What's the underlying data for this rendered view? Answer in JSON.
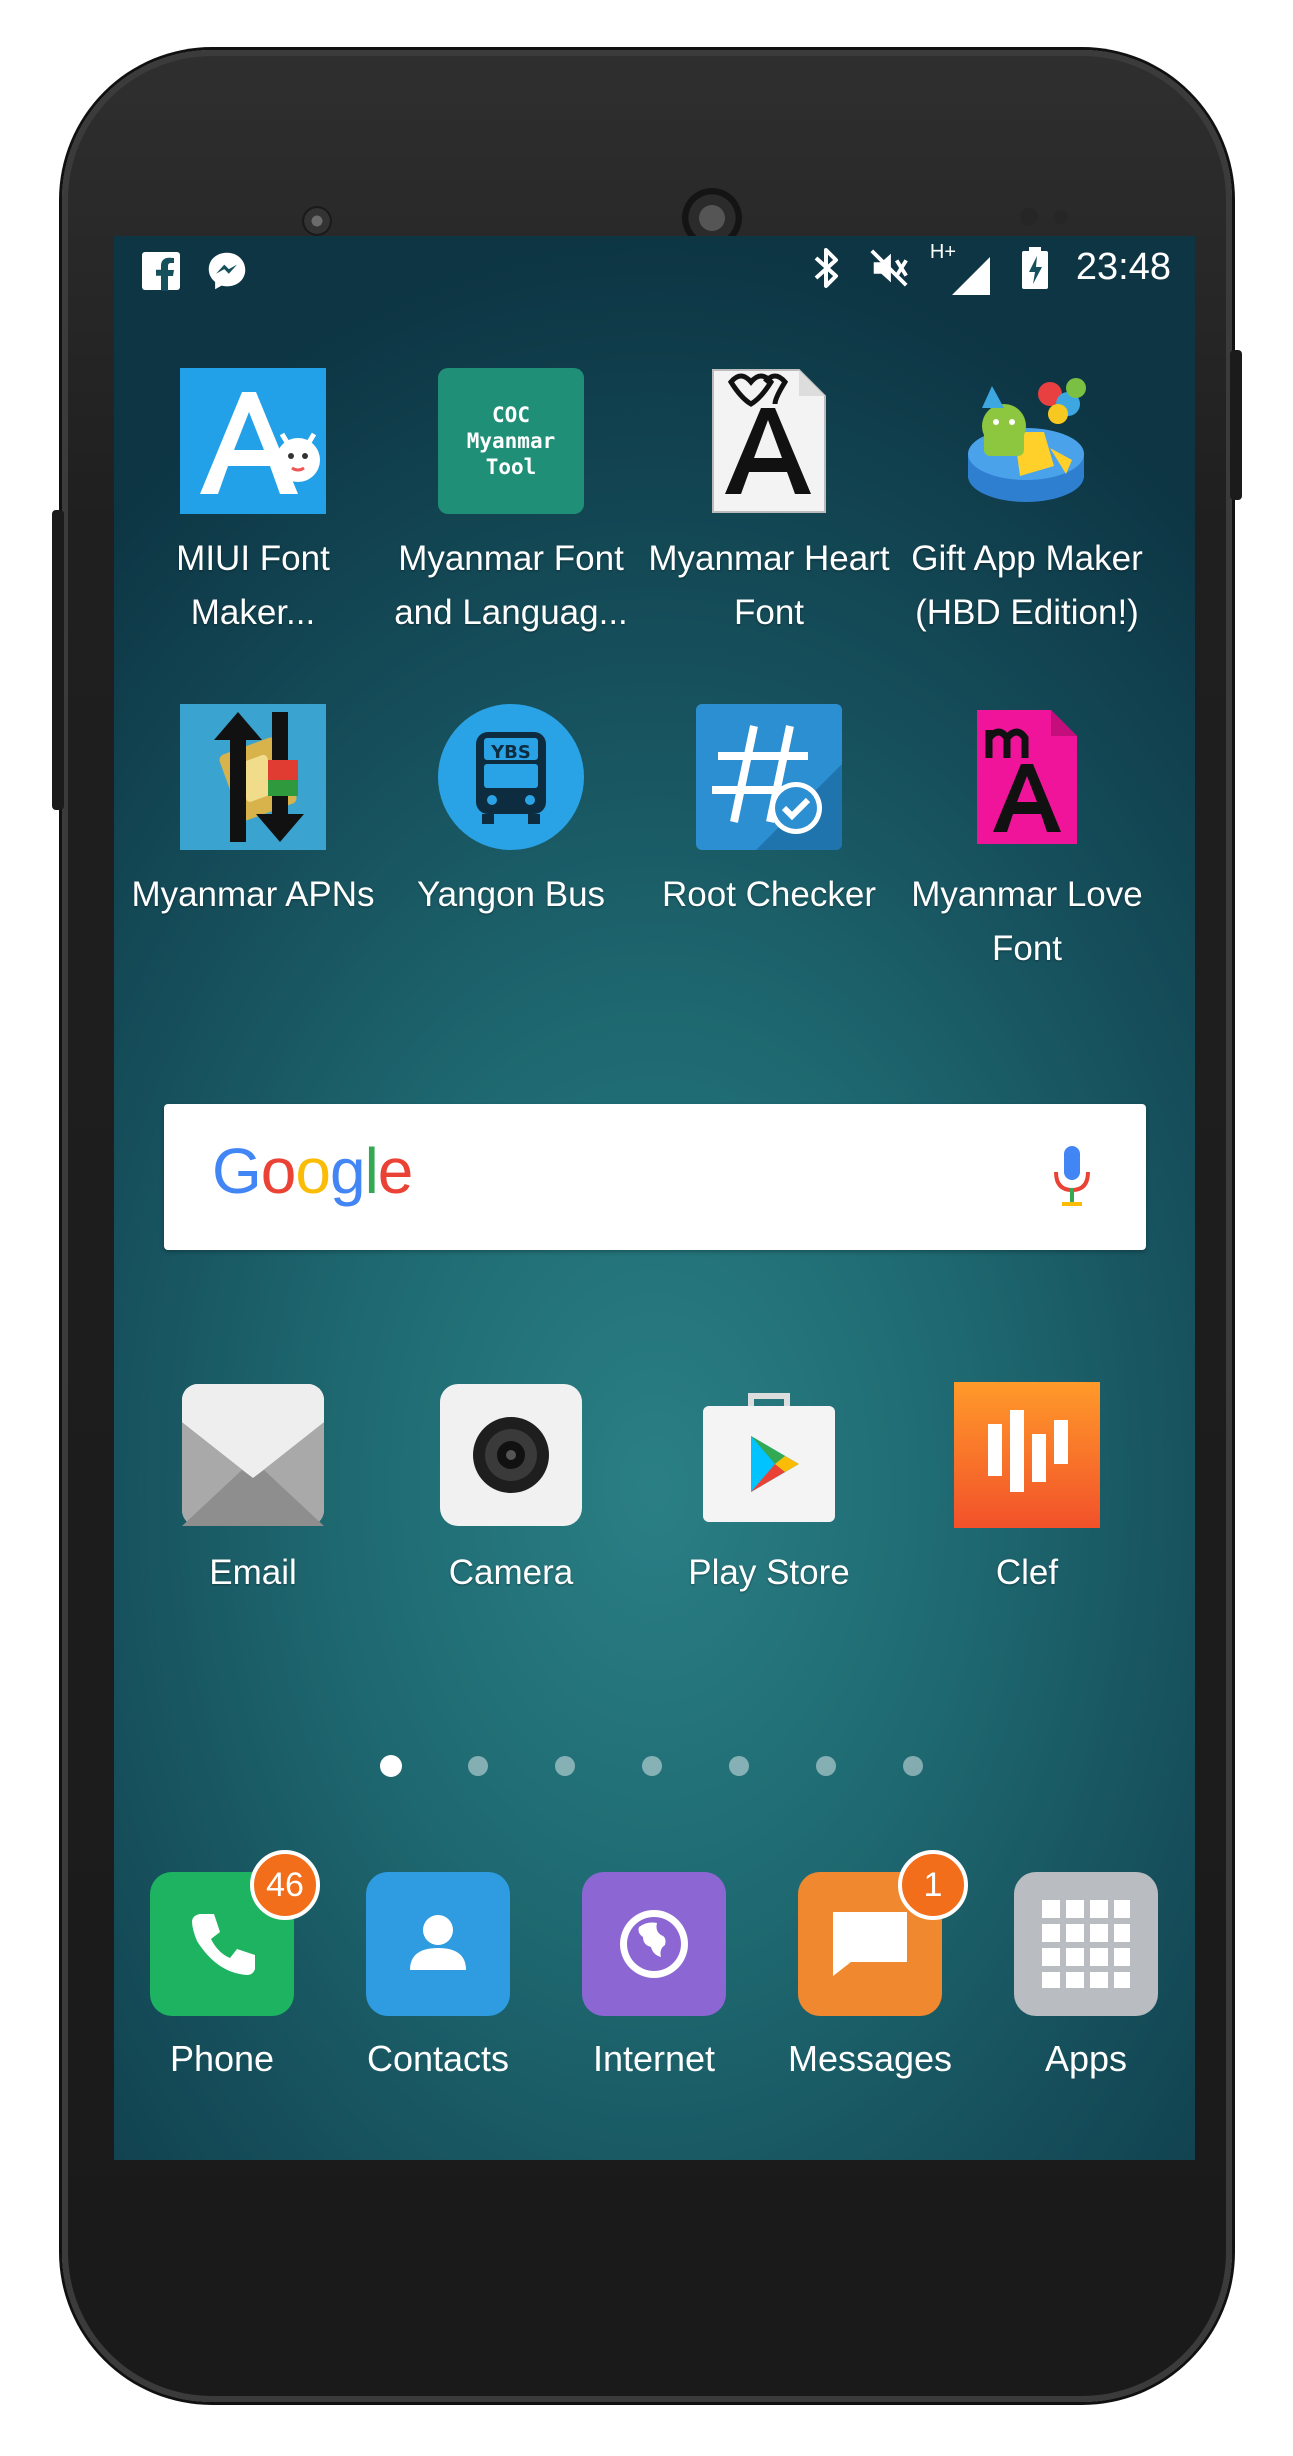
{
  "status_bar": {
    "left_icons": [
      "facebook-icon",
      "messenger-icon"
    ],
    "right_icons": [
      "bluetooth-icon",
      "vibrate-mute-icon",
      "signal-icon",
      "battery-charging-icon"
    ],
    "network_type": "H+",
    "time": "23:48"
  },
  "home_apps": [
    {
      "label": "MIUI Font\nMaker...",
      "icon": "miui-font-icon"
    },
    {
      "label": "Myanmar Font\nand Languag...",
      "icon": "coc-myanmar-icon",
      "icon_text": "COC Myanmar Tool"
    },
    {
      "label": "Myanmar Heart\nFont",
      "icon": "heart-font-icon"
    },
    {
      "label": "Gift App Maker\n(HBD Edition!)",
      "icon": "gift-app-icon"
    },
    {
      "label": "Myanmar APNs",
      "icon": "apn-icon"
    },
    {
      "label": "Yangon Bus",
      "icon": "bus-icon",
      "icon_text": "YBS"
    },
    {
      "label": "Root Checker",
      "icon": "root-checker-icon"
    },
    {
      "label": "Myanmar Love\nFont",
      "icon": "love-font-icon"
    },
    {
      "label": "Email",
      "icon": "email-icon"
    },
    {
      "label": "Camera",
      "icon": "camera-icon"
    },
    {
      "label": "Play Store",
      "icon": "play-store-icon"
    },
    {
      "label": "Clef",
      "icon": "clef-icon"
    }
  ],
  "search_widget": {
    "logo": "Google",
    "mic": "mic-icon"
  },
  "page_indicator": {
    "pages": 7,
    "current": 1
  },
  "dock": [
    {
      "label": "Phone",
      "icon": "phone-icon",
      "badge": "46",
      "color": "#1db360"
    },
    {
      "label": "Contacts",
      "icon": "contacts-icon",
      "badge": "",
      "color": "#2f9be0"
    },
    {
      "label": "Internet",
      "icon": "internet-icon",
      "badge": "",
      "color": "#8c67d3"
    },
    {
      "label": "Messages",
      "icon": "messages-icon",
      "badge": "1",
      "color": "#f0882f"
    },
    {
      "label": "Apps",
      "icon": "apps-grid-icon",
      "badge": "",
      "color": "#b9bcc1"
    }
  ]
}
